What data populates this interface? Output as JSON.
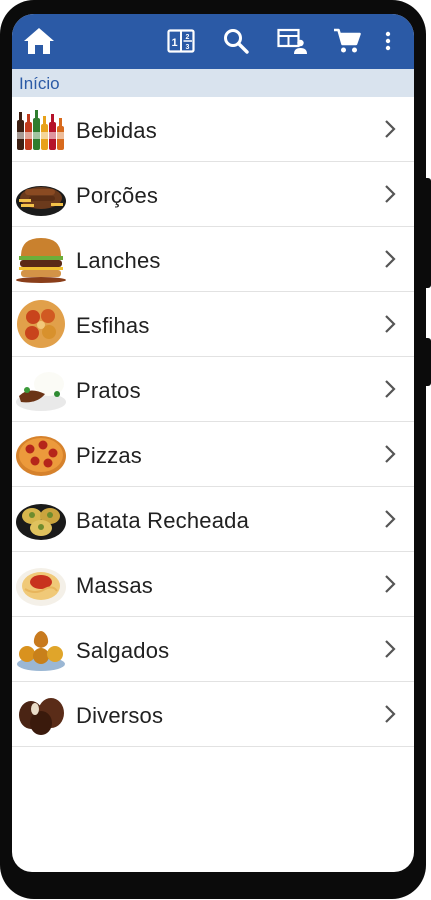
{
  "appbar": {
    "icons": [
      "home-icon",
      "calculator-icon",
      "search-icon",
      "table-person-icon",
      "cart-icon",
      "more-vert-icon"
    ],
    "color": "#2b5aa6"
  },
  "breadcrumb": {
    "label": "Início"
  },
  "categories": [
    {
      "label": "Bebidas",
      "icon": "drinks-thumbnail"
    },
    {
      "label": "Porções",
      "icon": "portions-thumbnail"
    },
    {
      "label": "Lanches",
      "icon": "burger-thumbnail"
    },
    {
      "label": "Esfihas",
      "icon": "esfiha-thumbnail"
    },
    {
      "label": "Pratos",
      "icon": "dish-thumbnail"
    },
    {
      "label": "Pizzas",
      "icon": "pizza-thumbnail"
    },
    {
      "label": "Batata Recheada",
      "icon": "stuffed-potato-thumbnail"
    },
    {
      "label": "Massas",
      "icon": "pasta-thumbnail"
    },
    {
      "label": "Salgados",
      "icon": "savory-snacks-thumbnail"
    },
    {
      "label": "Diversos",
      "icon": "chocolates-thumbnail"
    }
  ]
}
